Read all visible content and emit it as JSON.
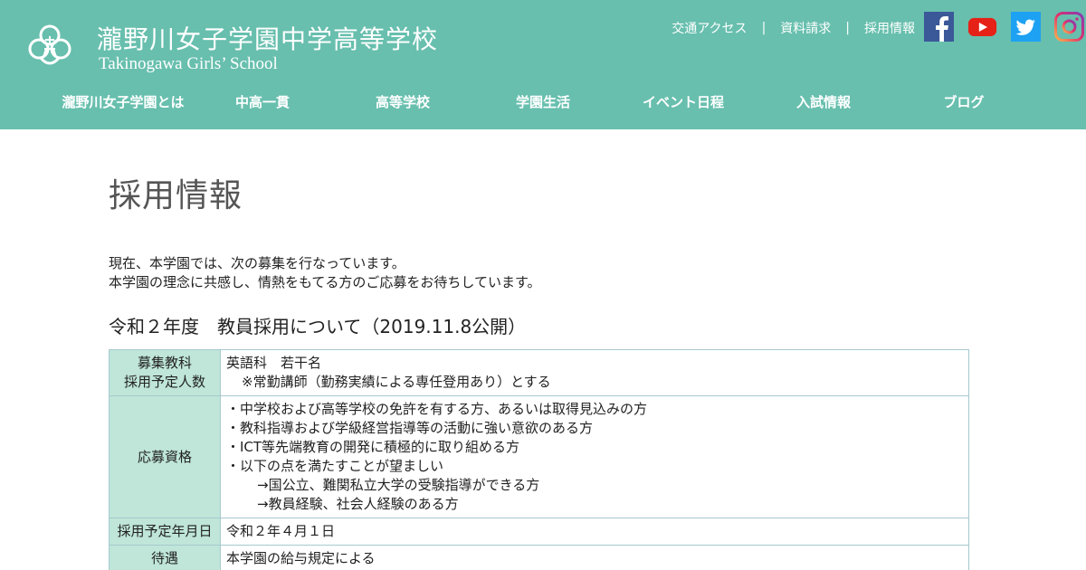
{
  "header": {
    "school_name_jp": "瀧野川女子学園中学高等学校",
    "school_name_en": "Takinogawa Girls’ School",
    "logo_icon": "school-crest-icon",
    "top_links": [
      "交通アクセス",
      "資料請求",
      "採用情報"
    ],
    "separator": "|",
    "social": [
      "facebook-icon",
      "youtube-icon",
      "twitter-icon",
      "instagram-icon"
    ],
    "bg_color": "#68bfae"
  },
  "nav": {
    "items": [
      "瀧野川女子学園とは",
      "中高一貫",
      "高等学校",
      "学園生活",
      "イベント日程",
      "入試情報",
      "ブログ"
    ]
  },
  "page": {
    "title": "採用情報",
    "intro": [
      "現在、本学園では、次の募集を行なっています。",
      "本学園の理念に共感し、情熱をもてる方のご応募をお待ちしています。"
    ],
    "section_title": "令和２年度　教員採用について（2019.11.8公開）"
  },
  "table": {
    "header_bg": "#bfe6d8",
    "rows": [
      {
        "label_lines": [
          "募集教科",
          "採用予定人数"
        ],
        "value_lines": [
          "英語科　若干名",
          "※常勤講師（勤務実績による専任登用あり）とする"
        ]
      },
      {
        "label": "応募資格",
        "value_lines": [
          "・中学校および高等学校の免許を有する方、あるいは取得見込みの方",
          "・教科指導および学級経営指導等の活動に強い意欲のある方",
          "・ICT等先端教育の開発に積極的に取り組める方",
          "・以下の点を満たすことが望ましい",
          "→国公立、難関私立大学の受験指導ができる方",
          "→教員経験、社会人経験のある方"
        ]
      },
      {
        "label": "採用予定年月日",
        "value": "令和２年４月１日"
      },
      {
        "label": "待遇",
        "value": "本学園の給与規定による"
      }
    ]
  }
}
